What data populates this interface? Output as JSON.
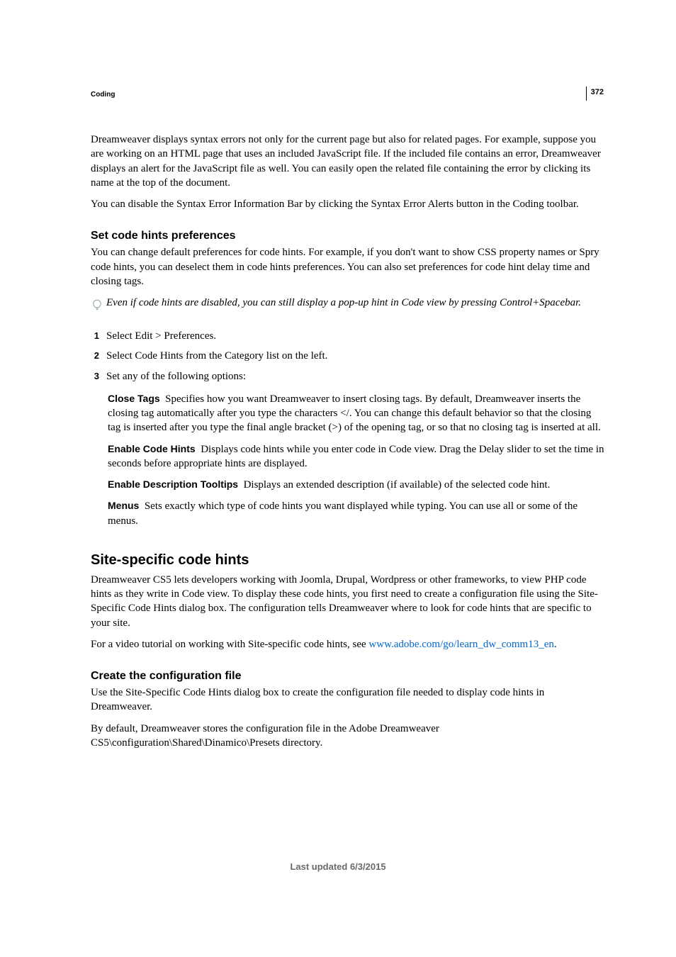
{
  "page_number": "372",
  "section_label": "Coding",
  "intro": {
    "p1": "Dreamweaver displays syntax errors not only for the current page but also for related pages. For example, suppose you are working on an HTML page that uses an included JavaScript file. If the included file contains an error, Dreamweaver displays an alert for the JavaScript file as well. You can easily open the related file containing the error by clicking its name at the top of the document.",
    "p2": "You can disable the Syntax Error Information Bar by clicking the Syntax Error Alerts button in the Coding toolbar."
  },
  "prefs": {
    "heading": "Set code hints preferences",
    "p1": "You can change default preferences for code hints. For example, if you don't want to show CSS property names or Spry code hints, you can deselect them in code hints preferences. You can also set preferences for code hint delay time and closing tags.",
    "tip": "Even if code hints are disabled, you can still display a pop-up hint in Code view by pressing Control+Spacebar.",
    "steps": [
      "Select Edit > Preferences.",
      "Select Code Hints from the Category list on the left.",
      "Set any of the following options:"
    ],
    "options": {
      "close_tags": {
        "label": "Close Tags",
        "text": "Specifies how you want Dreamweaver to insert closing tags. By default, Dreamweaver inserts the closing tag automatically after you type the characters </. You can change this default behavior so that the closing tag is inserted after you type the final angle bracket (>) of the opening tag, or so that no closing tag is inserted at all."
      },
      "enable_hints": {
        "label": "Enable Code Hints",
        "text": "Displays code hints while you enter code in Code view. Drag the Delay slider to set the time in seconds before appropriate hints are displayed."
      },
      "enable_tooltips": {
        "label": "Enable Description Tooltips",
        "text": "Displays an extended description (if available) of the selected code hint."
      },
      "menus": {
        "label": "Menus",
        "text": "Sets exactly which type of code hints you want displayed while typing. You can use all or some of the menus."
      }
    }
  },
  "site_specific": {
    "heading": "Site-specific code hints",
    "p1": "Dreamweaver CS5 lets developers working with Joomla, Drupal, Wordpress or other frameworks, to view PHP code hints as they write in Code view. To display these code hints, you first need to create a configuration file using the Site-Specific Code Hints dialog box. The configuration tells Dreamweaver where to look for code hints that are specific to your site.",
    "p2_pre": "For a video tutorial on working with Site-specific code hints, see ",
    "p2_link": "www.adobe.com/go/learn_dw_comm13_en",
    "p2_post": "."
  },
  "create_config": {
    "heading": "Create the configuration file",
    "p1": "Use the Site-Specific Code Hints dialog box to create the configuration file needed to display code hints in Dreamweaver.",
    "p2": "By default, Dreamweaver stores the configuration file in the Adobe Dreamweaver CS5\\configuration\\Shared\\Dinamico\\Presets directory."
  },
  "footer": "Last updated 6/3/2015"
}
